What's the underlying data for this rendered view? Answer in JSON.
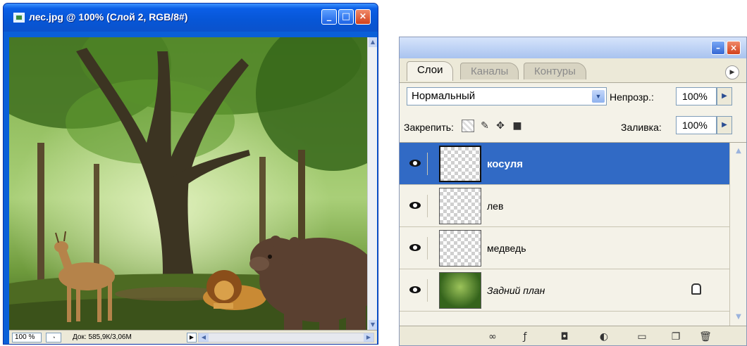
{
  "document": {
    "title": "лес.jpg @ 100% (Слой 2, RGB/8#)",
    "window_buttons": {
      "minimize": "_",
      "maximize": "□",
      "close": "×"
    },
    "status": {
      "zoom": "100 %",
      "doc_size": "Док: 585,9К/3,06М"
    },
    "icons": [
      "image-icon",
      "status-menu-icon",
      "play-arrow-icon",
      "scroll-left-icon",
      "scroll-right-icon",
      "scroll-up-icon",
      "scroll-down-icon"
    ]
  },
  "layers_panel": {
    "tabs": [
      {
        "label": "Слои",
        "active": true
      },
      {
        "label": "Каналы",
        "active": false
      },
      {
        "label": "Контуры",
        "active": false
      }
    ],
    "blend_mode": "Нормальный",
    "opacity_label": "Непрозр.:",
    "opacity_value": "100%",
    "lock_label": "Закрепить:",
    "fill_label": "Заливка:",
    "fill_value": "100%",
    "layers": [
      {
        "name": "косуля",
        "selected": true,
        "visible": true
      },
      {
        "name": "лев",
        "selected": false,
        "visible": true
      },
      {
        "name": "медведь",
        "selected": false,
        "visible": true
      },
      {
        "name": "Задний план",
        "selected": false,
        "visible": true,
        "locked": true
      }
    ],
    "selection_color": "#316ac5",
    "footer_icons": [
      "link-layers-icon",
      "layer-style-icon",
      "layer-mask-icon",
      "adjustment-layer-icon",
      "new-group-icon",
      "new-layer-icon",
      "delete-layer-icon"
    ]
  }
}
